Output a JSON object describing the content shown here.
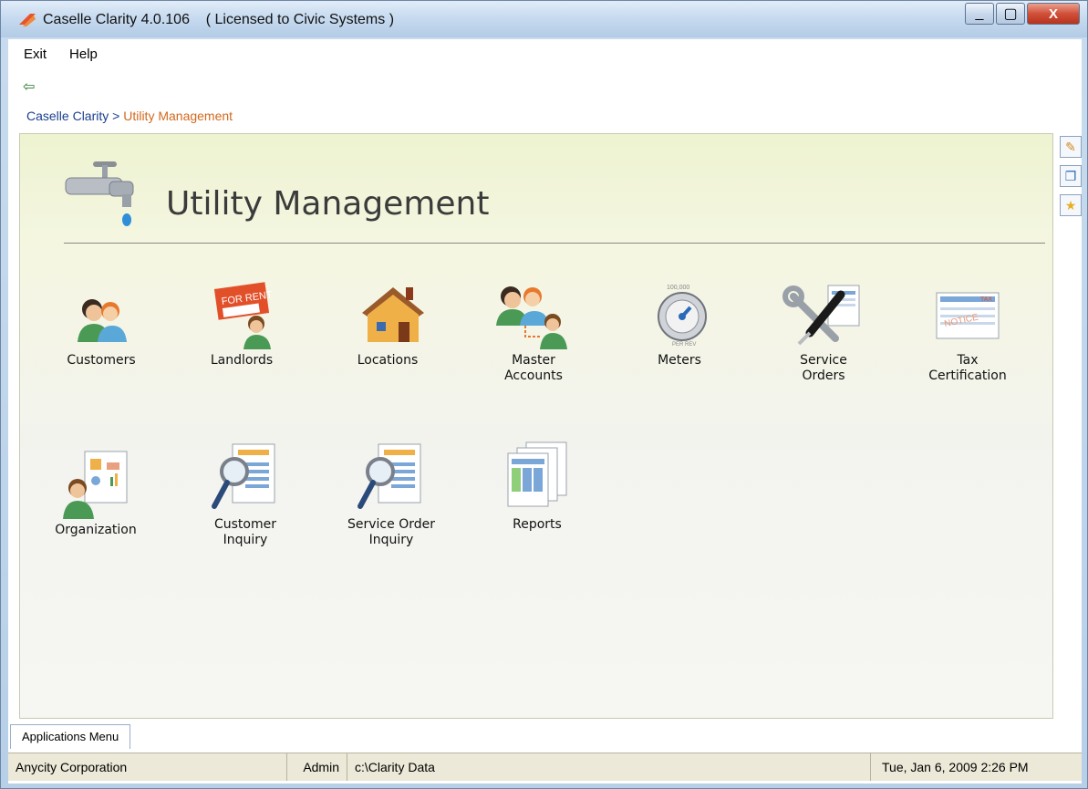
{
  "window": {
    "title": "Caselle Clarity 4.0.106",
    "license": "( Licensed to Civic Systems )",
    "minimize_label": "_",
    "maximize_label": "▢",
    "close_label": "X"
  },
  "menu": {
    "exit": "Exit",
    "help": "Help"
  },
  "toolbar": {
    "back_arrow": "⇦"
  },
  "breadcrumb": {
    "root": "Caselle Clarity",
    "separator": ">",
    "current": "Utility Management"
  },
  "page": {
    "title": "Utility Management"
  },
  "tiles": [
    {
      "label": "Customers",
      "icon": "customers-icon"
    },
    {
      "label": "Landlords",
      "icon": "for-rent-sign-icon"
    },
    {
      "label": "Locations",
      "icon": "house-icon"
    },
    {
      "label": "Master\nAccounts",
      "icon": "master-accounts-icon"
    },
    {
      "label": "Meters",
      "icon": "meter-dial-icon"
    },
    {
      "label": "Service\nOrders",
      "icon": "wrench-screwdriver-icon"
    },
    {
      "label": "Tax\nCertification",
      "icon": "tax-notice-icon"
    },
    {
      "label": "Organization",
      "icon": "organization-icon"
    },
    {
      "label": "Customer\nInquiry",
      "icon": "customer-inquiry-icon"
    },
    {
      "label": "Service Order\nInquiry",
      "icon": "service-order-inquiry-icon"
    },
    {
      "label": "Reports",
      "icon": "reports-icon"
    }
  ],
  "side_tools": [
    {
      "icon": "edit-note-icon",
      "glyph": "✎"
    },
    {
      "icon": "window-icon",
      "glyph": "❐"
    },
    {
      "icon": "favorite-star-icon",
      "glyph": "★"
    }
  ],
  "bottom_tab": {
    "label": "Applications Menu"
  },
  "status": {
    "company": "Anycity Corporation",
    "user": "Admin",
    "data_path": "c:\\Clarity Data",
    "datetime": "Tue, Jan 6, 2009 2:26 PM"
  },
  "colors": {
    "breadcrumb_current": "#d2691e",
    "breadcrumb_root": "#1a3f8f",
    "panel_top": "#eef3d1"
  }
}
